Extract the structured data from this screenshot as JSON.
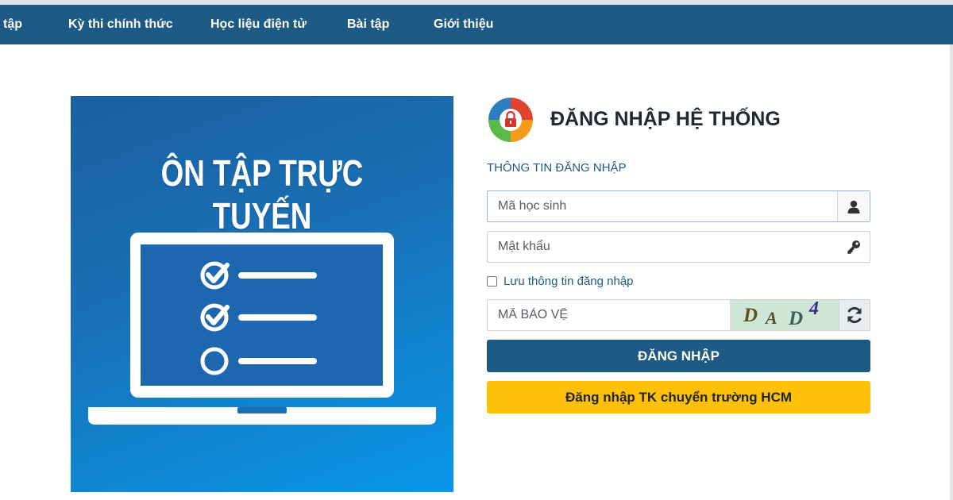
{
  "nav": {
    "items": [
      {
        "label": "tập"
      },
      {
        "label": "Kỳ thi chính thức"
      },
      {
        "label": "Học liệu điện tử"
      },
      {
        "label": "Bài tập"
      },
      {
        "label": "Giới thiệu"
      }
    ]
  },
  "banner": {
    "title": "ÔN TẬP TRỰC TUYẾN"
  },
  "login": {
    "title": "ĐĂNG NHẬP HỆ THỐNG",
    "section_label": "THÔNG TIN ĐĂNG NHẬP",
    "student_id_placeholder": "Mã học sinh",
    "password_placeholder": "Mật khẩu",
    "remember_label": "Lưu thông tin đăng nhập",
    "remember_checked": false,
    "captcha_placeholder": "MÃ BẢO VỆ",
    "captcha_chars": [
      "D",
      "A",
      "D",
      "4"
    ],
    "login_button": "ĐĂNG NHẬP",
    "transfer_button": "Đăng nhập TK chuyển trường HCM"
  },
  "icons": {
    "user": "user-icon",
    "key": "key-icon",
    "refresh": "refresh-icon",
    "logo": "lock-logo-icon"
  },
  "colors": {
    "navbar": "#1d5a84",
    "primary": "#1d5a84",
    "warning": "#ffc107",
    "banner_start": "#1a60a0",
    "banner_end": "#0897ea"
  }
}
